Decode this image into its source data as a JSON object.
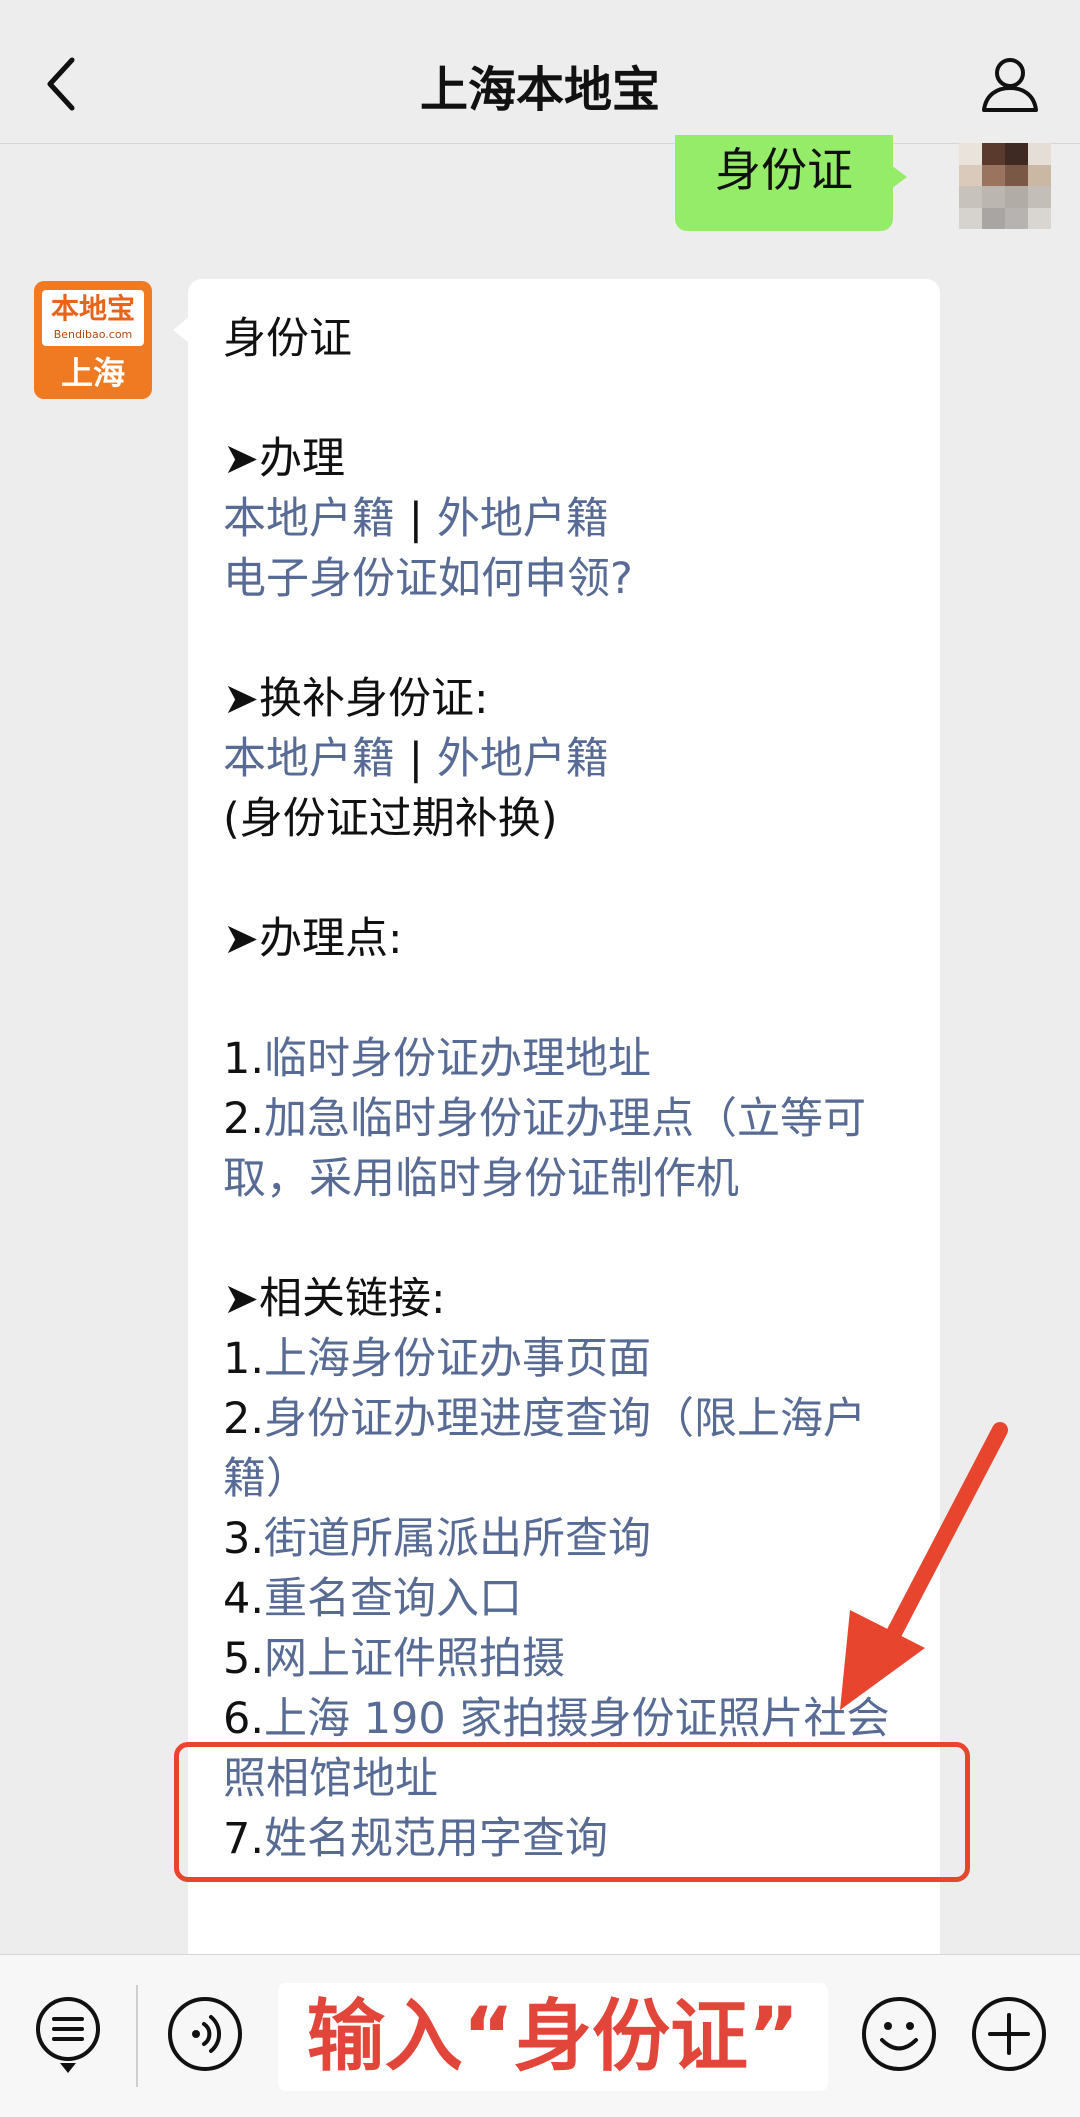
{
  "header": {
    "title": "上海本地宝"
  },
  "sent_message": {
    "text": "身份证"
  },
  "account": {
    "logo_text": "本地宝",
    "logo_subtext": "Bendibao.com",
    "logo_city": "上海"
  },
  "reply": {
    "heading": "身份证",
    "sec1_title": "➤办理",
    "sec1_link_local": "本地户籍",
    "sec1_sep": " | ",
    "sec1_link_nonlocal": "外地户籍",
    "sec1_link_eid": "电子身份证如何申领?",
    "sec2_title": "➤换补身份证:",
    "sec2_link_local": "本地户籍",
    "sec2_sep": " | ",
    "sec2_link_nonlocal": "外地户籍",
    "sec2_note": "(身份证过期补换)",
    "sec3_title": "➤办理点:",
    "sec3_item1_num": "1.",
    "sec3_item1_text": "临时身份证办理地址",
    "sec3_item2_num": "2.",
    "sec3_item2_text": "加急临时身份证办理点（立等可取，采用临时身份证制作机",
    "sec4_title": "➤相关链接:",
    "links": [
      {
        "num": "1.",
        "text": "上海身份证办事页面"
      },
      {
        "num": "2.",
        "text": "身份证办理进度查询（限上海户籍）"
      },
      {
        "num": "3.",
        "text": "街道所属派出所查询"
      },
      {
        "num": "4.",
        "text": "重名查询入口"
      },
      {
        "num": "5.",
        "text": "网上证件照拍摄"
      },
      {
        "num": "6.",
        "text": "上海 190 家拍摄身份证照片社会照相馆地址"
      },
      {
        "num": "7.",
        "text": "姓名规范用字查询"
      }
    ]
  },
  "input": {
    "overlay_text": "输入“身份证”"
  },
  "colors": {
    "link": "#576b95",
    "sent_bubble": "#95ec69",
    "highlight": "#e8452e",
    "logo": "#ef7a22"
  },
  "icons": [
    "chevron-left-icon",
    "person-icon",
    "menu-icon",
    "voice-icon",
    "emoji-icon",
    "plus-icon"
  ]
}
